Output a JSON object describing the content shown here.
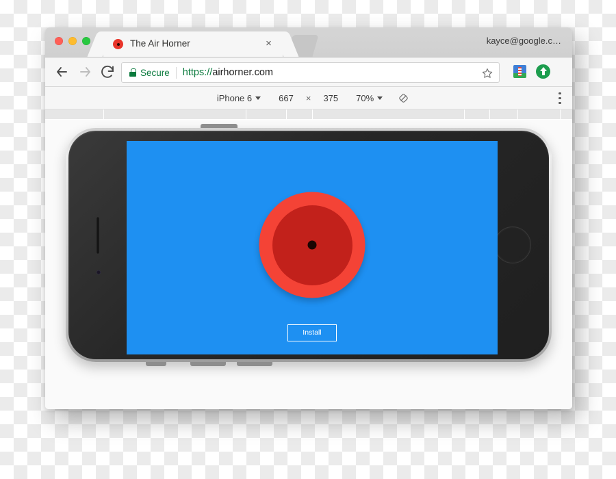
{
  "window": {
    "traffic_lights": [
      "close",
      "minimize",
      "maximize"
    ],
    "account_label": "kayce@google.c…"
  },
  "tab": {
    "title": "The Air Horner",
    "close_label": "×",
    "favicon": "air-horn-red-circle-icon"
  },
  "toolbar": {
    "back_icon": "back-arrow-icon",
    "forward_icon": "forward-arrow-icon",
    "reload_icon": "reload-icon",
    "security_label": "Secure",
    "lock_icon": "lock-icon",
    "url_scheme": "https://",
    "url_host": "airhorner.com",
    "bookmark_icon": "star-icon",
    "extensions": [
      {
        "name": "lighthouse-extension-icon"
      },
      {
        "name": "upload-extension-icon"
      }
    ]
  },
  "device_bar": {
    "device_name": "iPhone 6",
    "device_caret": "▼",
    "width": "667",
    "times": "×",
    "height": "375",
    "zoom": "70%",
    "zoom_caret": "▼",
    "rotate_icon": "rotate-device-icon",
    "menu_icon": "kebab-menu-icon"
  },
  "ruler": {
    "ticks": [
      85,
      293,
      352,
      390,
      612,
      649,
      690,
      752
    ]
  },
  "device": {
    "model": "iphone-6",
    "orientation": "landscape",
    "earpiece": "earpiece-speaker",
    "camera": "front-camera",
    "home_button": "home-button",
    "power_button": "power-button",
    "volume_buttons": [
      "volume-up",
      "volume-down",
      "mute-switch"
    ]
  },
  "page": {
    "background_color": "#1e90f2",
    "horn": {
      "name": "air-horn-button",
      "outer_color": "#f44336",
      "inner_color": "#c2211b",
      "center_color": "#1a0502"
    },
    "install_label": "Install"
  }
}
